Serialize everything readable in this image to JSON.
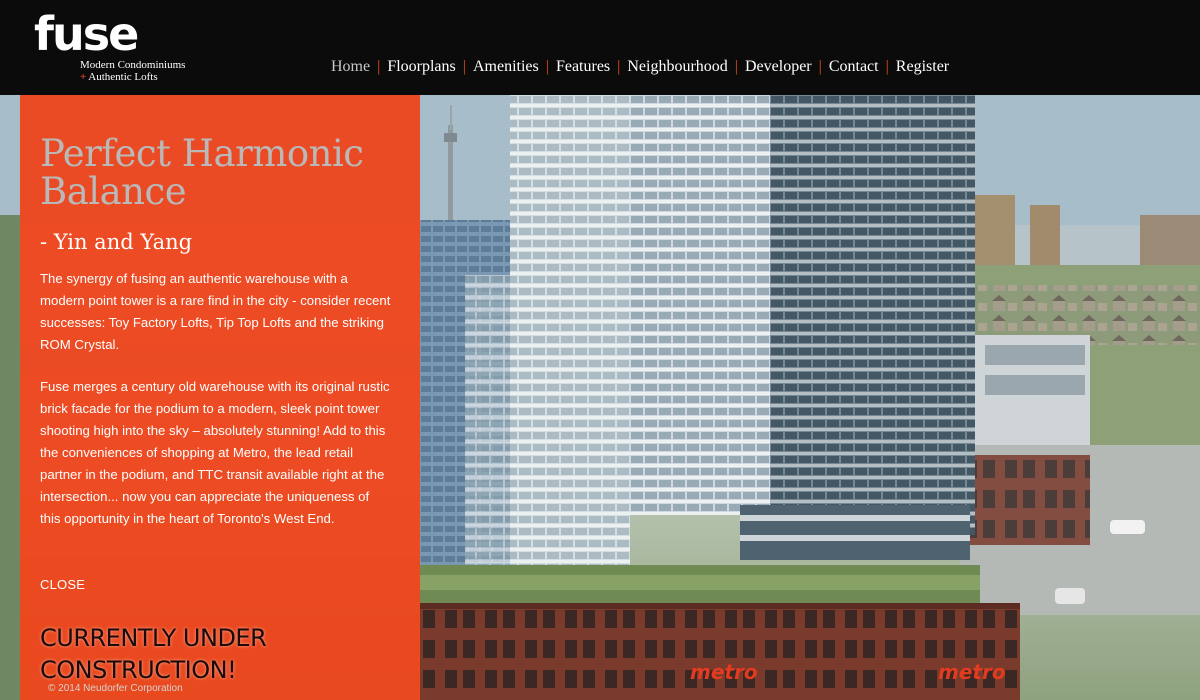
{
  "brand": {
    "name": "fuse",
    "tagline_line1": "Modern Condominiums",
    "tagline_line2": "Authentic Lofts",
    "plus_symbol": "+",
    "accent_color": "#e84a23"
  },
  "nav": {
    "separator": "|",
    "items": [
      {
        "label": "Home",
        "active": true
      },
      {
        "label": "Floorplans"
      },
      {
        "label": "Amenities"
      },
      {
        "label": "Features"
      },
      {
        "label": "Neighbourhood"
      },
      {
        "label": "Developer"
      },
      {
        "label": "Contact"
      },
      {
        "label": "Register"
      }
    ]
  },
  "panel": {
    "title": "Perfect Harmonic Balance",
    "subtitle": "- Yin and Yang",
    "paragraph1": "The synergy of fusing an authentic warehouse with a modern point tower is a rare find in the city - consider recent successes: Toy Factory Lofts, Tip Top Lofts and the striking ROM Crystal.",
    "paragraph2": "Fuse merges a century old warehouse with its original rustic brick facade for the podium to a modern, sleek point tower shooting high into the sky – absolutely stunning! Add to this the conveniences of shopping at Metro, the lead retail partner in the podium, and TTC transit available right at the intersection... now you can appreciate the uniqueness of this opportunity in the heart of Toronto's West End.",
    "close_label": "CLOSE",
    "banner": "CURRENTLY UNDER CONSTRUCTION!",
    "background_color": "#f04218"
  },
  "hero": {
    "storefront_sign": "metro"
  },
  "footer": {
    "copyright": "© 2014 Neudorfer Corporation"
  }
}
